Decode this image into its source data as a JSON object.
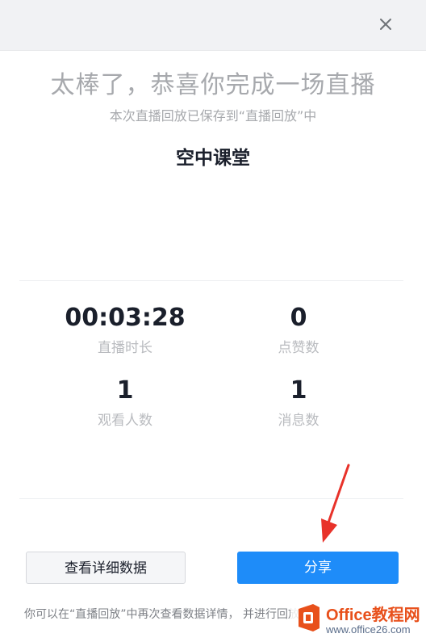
{
  "dialog": {
    "close_icon": "close-icon"
  },
  "header": {
    "headline": "太棒了，恭喜你完成一场直播",
    "subline": "本次直播回放已保存到“直播回放”中"
  },
  "course": {
    "title": "空中课堂"
  },
  "stats": [
    {
      "value": "00:03:28",
      "label": "直播时长"
    },
    {
      "value": "0",
      "label": "点赞数"
    },
    {
      "value": "1",
      "label": "观看人数"
    },
    {
      "value": "1",
      "label": "消息数"
    }
  ],
  "actions": {
    "detail_label": "查看详细数据",
    "share_label": "分享"
  },
  "footer": {
    "note": "你可以在“直播回放”中再次查看数据详情， 并进行回放"
  },
  "colors": {
    "accent": "#1e8cf9",
    "annotation_arrow": "#e8322a",
    "watermark": "#e8501b"
  },
  "watermark": {
    "title": "Office教程网",
    "url": "www.office26.com"
  }
}
